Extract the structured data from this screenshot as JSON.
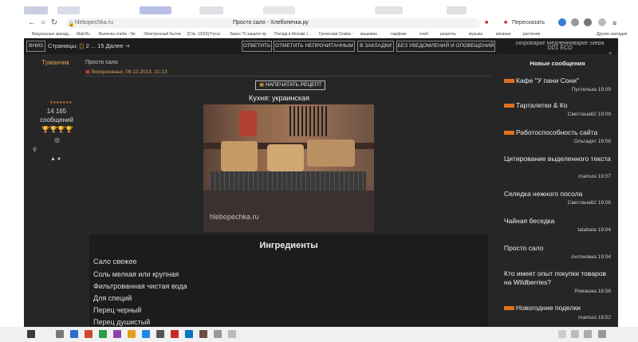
{
  "browser": {
    "url_host": "hlebopechka.ru",
    "page_title": "Просто сало - Хлебопечка.ру",
    "translate_label": "Пересказать",
    "bookmarks": [
      "Визуальные заклад...",
      "Mail.Ru",
      "Выпечка хлеба - Ne",
      "Электронный бытов",
      "[Стр. 12/33] Русск",
      "Закон \"О защите пр",
      "Погода в Москве (...",
      "Греческая Олива -",
      "вышивка",
      "парфюм",
      "хлеб",
      "рецепты",
      "музыка",
      "вязание",
      "растения",
      "Другие закладки"
    ]
  },
  "topbar": {
    "down_button": "ВНИЗ",
    "pages_label": "Страницы:",
    "pages_text": "2 ... 15",
    "next_label": "Далее",
    "reply_button": "ОТВЕТИТЬ",
    "mark_unread_button": "ОТМЕТИТЬ НЕПРОЧИТАННЫМ",
    "bookmark_button": "В ЗАКЛАДКИ",
    "no_notify_button": "БЕЗ УВЕДОМЛЕНИЙ И ОПОВЕЩЕНИЙ",
    "sidebar_title": "скороварке Медленноварке Steba DD1 ECO"
  },
  "author": {
    "name": "Туманчик",
    "post_count": "14 165",
    "post_count_label": "сообщений"
  },
  "post": {
    "title": "Просто сало",
    "date": "Воскресенье, 08.12.2013, 21:13",
    "print_button": "НАПЕЧАТАТЬ РЕЦЕПТ",
    "cuisine": "Кухня: украинская",
    "watermark": "hlebopechka.ru",
    "ingredients_title": "Ингредиенты",
    "ingredients": [
      "Сало свежее",
      "Соль мелкая или крупная",
      "Фильтрованная чистая вода",
      "Для специй",
      "Перец черный",
      "Перец душистый"
    ]
  },
  "sidebar": {
    "heading": "Новые сообщения",
    "items": [
      {
        "title": "Кафе \"У пани Сони\"",
        "meta": "Пустелька 19:09",
        "badge": true
      },
      {
        "title": "Тарталетки & Ко",
        "meta": "Светлана62 19:09",
        "badge": true
      },
      {
        "title": "Работоспособность сайта",
        "meta": "Ольгадет 19:08",
        "badge": true
      },
      {
        "title": "Цитирование выделенного текста",
        "meta": "mamusi 19:07",
        "badge": false
      },
      {
        "title": "Селедка нежного посола",
        "meta": "Светлана62 19:06",
        "badge": false
      },
      {
        "title": "Чайная беседка",
        "meta": "tatabata 19:04",
        "badge": false
      },
      {
        "title": "Просто сало",
        "meta": "Антоновка 19:04",
        "badge": false
      },
      {
        "title": "Кто имеет опыт покупки товаров на Wildberries?",
        "meta": "Ромашка 18:56",
        "badge": false
      },
      {
        "title": "Новогодние поделки",
        "meta": "mamusi 18:52",
        "badge": true
      }
    ]
  }
}
